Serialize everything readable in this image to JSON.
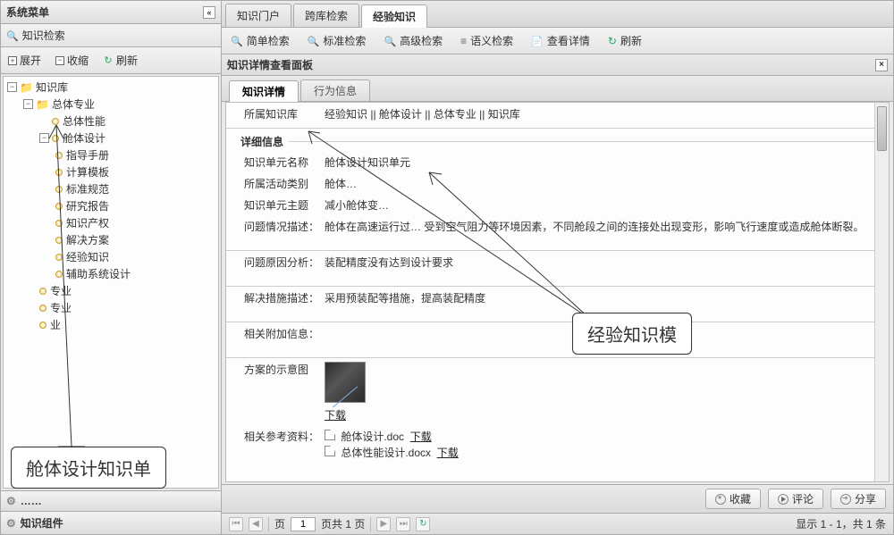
{
  "sidebar": {
    "title": "系统菜单",
    "search_label": "知识检索",
    "toolbar": {
      "expand": "展开",
      "collapse": "收缩",
      "refresh": "刷新"
    },
    "tree": {
      "root": "知识库",
      "n1": "总体专业",
      "n1a": "总体性能",
      "n1b": "舱体设计",
      "leaves": {
        "l1": "指导手册",
        "l2": "计算模板",
        "l3": "标准规范",
        "l4": "研究报告",
        "l5": "知识产权",
        "l6": "解决方案",
        "l7": "经验知识",
        "l8": "辅助系统设计"
      },
      "n2": "专业",
      "n3": "专业",
      "n4": "业"
    },
    "stack1": "……",
    "stack2": "知识组件"
  },
  "main": {
    "tabs": {
      "t1": "知识门户",
      "t2": "跨库检索",
      "t3": "经验知识"
    },
    "toolbar": {
      "simple": "简单检索",
      "standard": "标准检索",
      "advanced": "高级检索",
      "semantic": "语义检索",
      "viewdetail": "查看详情",
      "refresh": "刷新"
    },
    "panel_title": "知识详情查看面板",
    "sub_tabs": {
      "t1": "知识详情",
      "t2": "行为信息"
    },
    "detail": {
      "belong_repo_label": "所属知识库",
      "belong_repo_value": "经验知识 || 舱体设计 || 总体专业 || 知识库",
      "section_title": "详细信息",
      "unit_name_label": "知识单元名称",
      "unit_name_value": "舱体设计知识单元",
      "activity_label": "所属活动类别",
      "activity_value": "舱体…",
      "topic_label": "知识单元主题",
      "topic_value": "减小舱体变…",
      "problem_desc_label": "问题情况描述：",
      "problem_desc_value": "舱体在高速运行过…          受到空气阻力等环境因素，不同舱段之间的连接处出现变形，影响飞行速度或造成舱体断裂。",
      "cause_label": "问题原因分析：",
      "cause_value": "装配精度没有达到设计要求",
      "solution_label": "解决措施描述：",
      "solution_value": "采用预装配等措施，提高装配精度",
      "extra_label": "相关附加信息：",
      "diagram_label": "方案的示意图",
      "download": "下载",
      "ref_label": "相关参考资料：",
      "ref1": "舱体设计.doc",
      "ref2": "总体性能设计.docx"
    },
    "footer": {
      "fav": "收藏",
      "comment": "评论",
      "share": "分享"
    },
    "paging": {
      "page_label_pre": "页",
      "page_value": "1",
      "page_label_post": "页共 1 页",
      "status": "显示 1 - 1，共 1 条"
    }
  },
  "callouts": {
    "left": "舱体设计知识单",
    "right": "经验知识模"
  }
}
